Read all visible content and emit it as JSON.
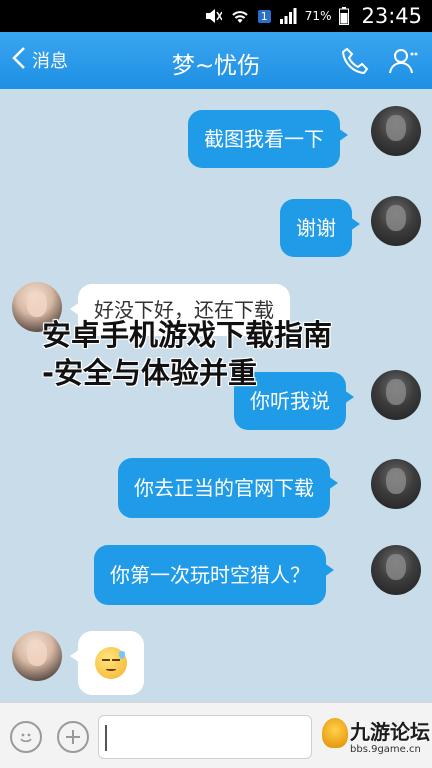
{
  "status_bar": {
    "battery": "71%",
    "sim": "1",
    "time": "23:45"
  },
  "nav": {
    "back_label": "消息",
    "title": "梦~忧伤"
  },
  "messages": [
    {
      "sender": "self",
      "text": "截图我看一下"
    },
    {
      "sender": "self",
      "text": "谢谢"
    },
    {
      "sender": "other",
      "text": "好没下好，还在下载"
    },
    {
      "sender": "self",
      "text": "你听我说"
    },
    {
      "sender": "self",
      "text": "你去正当的官网下载"
    },
    {
      "sender": "self",
      "text": "你第一次玩时空猎人？"
    },
    {
      "sender": "other",
      "text": "",
      "emoji": "sweat-smile-emoji"
    }
  ],
  "overlay": {
    "line1": "安卓手机游戏下载指南",
    "line2": "-安全与体验并重"
  },
  "watermark": {
    "brand": "九游论坛",
    "site": "bbs.9game.cn"
  },
  "colors": {
    "nav_bar": "#1e8fe3",
    "self_bubble": "#1f9be8",
    "chat_background": "#c9dce9"
  }
}
